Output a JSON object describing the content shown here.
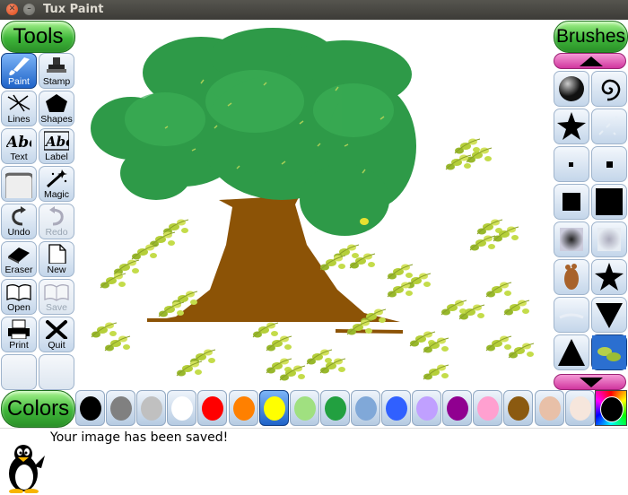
{
  "window": {
    "title": "Tux Paint"
  },
  "headers": {
    "tools": "Tools",
    "brushes": "Brushes",
    "colors": "Colors"
  },
  "tools": [
    {
      "name": "paint",
      "label": "Paint",
      "icon": "paintbrush-icon",
      "active": true
    },
    {
      "name": "stamp",
      "label": "Stamp",
      "icon": "stamp-icon"
    },
    {
      "name": "lines",
      "label": "Lines",
      "icon": "lines-icon"
    },
    {
      "name": "shapes",
      "label": "Shapes",
      "icon": "pentagon-icon"
    },
    {
      "name": "text",
      "label": "Text",
      "icon": "text-abc-icon"
    },
    {
      "name": "label",
      "label": "Label",
      "icon": "label-abc-icon"
    },
    {
      "name": "fill",
      "label": "",
      "icon": "square-icon"
    },
    {
      "name": "magic",
      "label": "Magic",
      "icon": "magic-wand-icon"
    },
    {
      "name": "undo",
      "label": "Undo",
      "icon": "undo-icon"
    },
    {
      "name": "redo",
      "label": "Redo",
      "icon": "redo-icon",
      "disabled": true
    },
    {
      "name": "eraser",
      "label": "Eraser",
      "icon": "eraser-icon"
    },
    {
      "name": "new",
      "label": "New",
      "icon": "new-page-icon"
    },
    {
      "name": "open",
      "label": "Open",
      "icon": "open-book-icon"
    },
    {
      "name": "save",
      "label": "Save",
      "icon": "save-book-icon",
      "disabled": true
    },
    {
      "name": "print",
      "label": "Print",
      "icon": "printer-icon"
    },
    {
      "name": "quit",
      "label": "Quit",
      "icon": "quit-x-icon"
    }
  ],
  "brushes": [
    "sphere-brush-icon",
    "spiral-brush-icon",
    "star-blob-brush-icon",
    "sparkle-brush-icon",
    "small-dot-brush-icon",
    "tiny-square-brush-icon",
    "square-brush-icon",
    "large-square-brush-icon",
    "fuzzy-square-brush-icon",
    "fuzzy-soft-brush-icon",
    "footprint-brush-icon",
    "star-brush-icon",
    "light-smudge-brush-icon",
    "triangle-down-brush-icon",
    "triangle-up-brush-icon",
    "leaves-brush-icon"
  ],
  "palette": {
    "colors": [
      "#000000",
      "#808080",
      "#c0c0c0",
      "#ffffff",
      "#ff0000",
      "#ff8000",
      "#ffff00",
      "#a0e080",
      "#22a040",
      "#80a8d8",
      "#3060ff",
      "#c0a0ff",
      "#900090",
      "#ffa0d0",
      "#8b5a10",
      "#e8c0a8",
      "#f6e6dc"
    ],
    "selected": "#ffff00"
  },
  "status": {
    "message": "Your image has been saved!"
  }
}
